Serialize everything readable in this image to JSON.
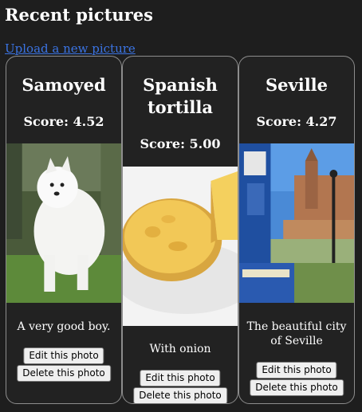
{
  "page": {
    "title": "Recent pictures",
    "upload_link": "Upload a new picture"
  },
  "cards": [
    {
      "title": "Samoyed",
      "score": "Score: 4.52",
      "caption": "A very good boy.",
      "edit_label": "Edit this photo",
      "delete_label": "Delete this photo"
    },
    {
      "title": "Spanish tortilla",
      "score": "Score: 5.00",
      "caption": "With onion",
      "edit_label": "Edit this photo",
      "delete_label": "Delete this photo"
    },
    {
      "title": "Seville",
      "score": "Score: 4.27",
      "caption": "The beautiful city of Seville",
      "edit_label": "Edit this photo",
      "delete_label": "Delete this photo"
    }
  ]
}
